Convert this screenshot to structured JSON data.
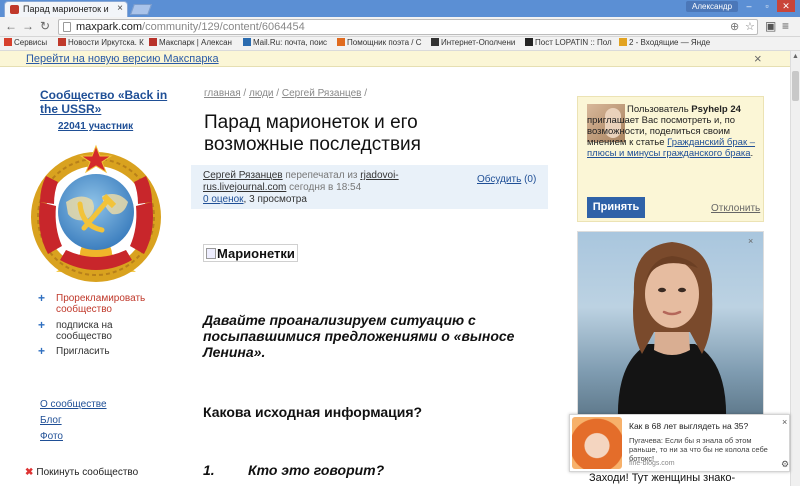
{
  "browser": {
    "tab_title": "Парад марионеток и е",
    "tab_close": "×",
    "user_name": "Александр",
    "url_host": "maxpark.com",
    "url_path": "/community/129/content/6064454",
    "bookmarks": [
      {
        "label": "Сервисы",
        "color": "#d6402d"
      },
      {
        "label": "Новости Иркутска. К",
        "color": "#c0392b"
      },
      {
        "label": "Макспарк | Алексан",
        "color": "#b8322a"
      },
      {
        "label": "Mail.Ru: почта, поис",
        "color": "#2b6cb0"
      },
      {
        "label": "Помощник поэта / С",
        "color": "#e06b1f"
      },
      {
        "label": "Интернет-Ополчени",
        "color": "#333333"
      },
      {
        "label": "Пост LOPATIN :: Пол",
        "color": "#222222"
      },
      {
        "label": "2 - Входящие — Янде",
        "color": "#e2a321"
      }
    ]
  },
  "notice": {
    "link": "Перейти на новую версию Макспарка",
    "close": "×"
  },
  "sidebar": {
    "community_name": "Сообщество «Back in the USSR»",
    "members": "22041 участник",
    "actions": [
      {
        "label": "Прорекламировать сообщество",
        "color": "#c0392b"
      },
      {
        "label": "подписка на сообщество",
        "color": "#333333"
      },
      {
        "label": "Пригласить",
        "color": "#333333"
      }
    ],
    "links": [
      "О сообществе",
      "Блог",
      "Фото"
    ],
    "leave": "Покинуть сообщество"
  },
  "article": {
    "breadcrumbs": [
      "главная",
      "люди",
      "Сергей Рязанцев"
    ],
    "title": "Парад марионеток и его возможные последствия",
    "author": "Сергей Рязанцев",
    "reposted_text": "перепечатал из",
    "source": "rjadovoi-rus.livejournal.com",
    "time": "сегодня в 18:54",
    "ratings": "0 оценок",
    "views": ", 3 просмотра",
    "discuss_label": "Обсудить",
    "discuss_count": "(0)",
    "image_alt": "Марионетки",
    "paragraph1": "Давайте проанализируем ситуацию с посыпавшимися предложениями о «выносе Ленина».",
    "heading": "Какова исходная информация?",
    "list_number": "1.",
    "list_item": "Кто это говорит?"
  },
  "invite": {
    "prefix": "Пользователь",
    "user": "Psyhelp 24",
    "text": "приглашает Вас посмотреть и, по возможности, поделиться своим мнением к статье",
    "article_link": "Гражданский брак – плюсы и минусы гражданского брака",
    "accept": "Принять",
    "decline": "Отклонить"
  },
  "ad": {
    "close": "×"
  },
  "popup": {
    "title": "Как в 68 лет выглядеть на 35?",
    "text": "Пугачева: Если бы я знала об этом раньше, то ни за что бы не колола себе ботокс!",
    "source": "fine-blogs.com",
    "close": "×",
    "below_text": "Заходи! Тут женщины знако-"
  }
}
